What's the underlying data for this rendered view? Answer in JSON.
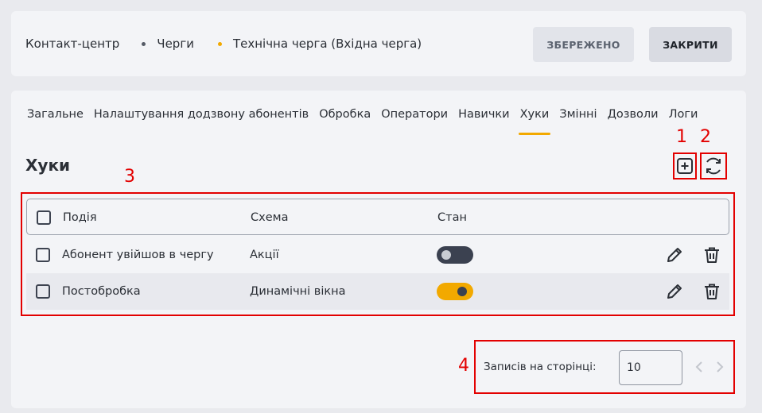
{
  "header": {
    "breadcrumb": [
      "Контакт-центр",
      "Черги",
      "Технічна черга (Вхідна черга)"
    ],
    "saved_label": "ЗБЕРЕЖЕНО",
    "close_label": "ЗАКРИТИ"
  },
  "tabs": [
    {
      "label": "Загальне",
      "active": false
    },
    {
      "label": "Налаштування додзвону абонентів",
      "active": false
    },
    {
      "label": "Обробка",
      "active": false
    },
    {
      "label": "Оператори",
      "active": false
    },
    {
      "label": "Навички",
      "active": false
    },
    {
      "label": "Хуки",
      "active": true
    },
    {
      "label": "Змінні",
      "active": false
    },
    {
      "label": "Дозволи",
      "active": false
    },
    {
      "label": "Логи",
      "active": false
    }
  ],
  "section": {
    "title": "Хуки"
  },
  "annotations": [
    "1",
    "2",
    "3",
    "4"
  ],
  "table": {
    "columns": [
      "Подія",
      "Схема",
      "Стан"
    ],
    "rows": [
      {
        "event": "Абонент увійшов в чергу",
        "schema": "Акції",
        "enabled": false
      },
      {
        "event": "Постобробка",
        "schema": "Динамічні вікна",
        "enabled": true
      }
    ]
  },
  "pagination": {
    "per_page_label": "Записів на сторінці:",
    "per_page_value": "10"
  },
  "colors": {
    "accent": "#f2a900",
    "annotation": "#e30000",
    "toggle_off": "#3b4150"
  },
  "icons": [
    "add-square-icon",
    "refresh-icon",
    "pencil-icon",
    "trash-icon",
    "chevron-left-icon",
    "chevron-right-icon"
  ]
}
